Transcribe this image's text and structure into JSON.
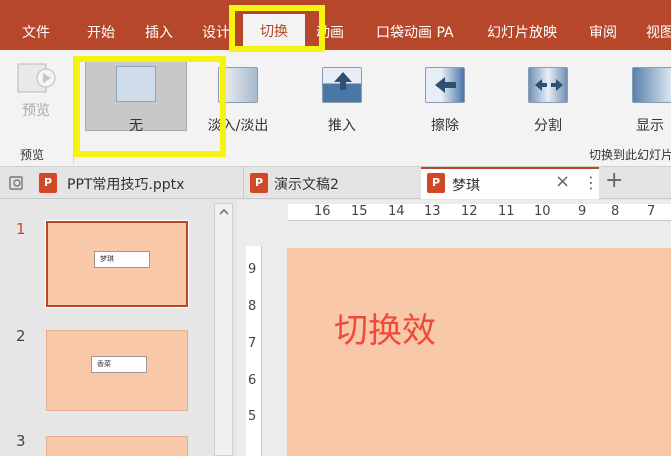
{
  "ribbon_tabs": [
    "文件",
    "开始",
    "插入",
    "设计",
    "切换",
    "动画",
    "口袋动画 PA",
    "幻灯片放映",
    "审阅",
    "视图"
  ],
  "active_tab": "切换",
  "preview_group": {
    "button_label": "预览",
    "group_label": "预览"
  },
  "transitions": [
    {
      "label": "无",
      "selected": true
    },
    {
      "label": "淡入/淡出"
    },
    {
      "label": "推入"
    },
    {
      "label": "擦除"
    },
    {
      "label": "分割"
    },
    {
      "label": "显示"
    }
  ],
  "transition_group_label": "切换到此幻灯片",
  "document_tabs": [
    {
      "title": "PPT常用技巧.pptx"
    },
    {
      "title": "演示文稿2"
    },
    {
      "title": "梦琪",
      "active": true
    }
  ],
  "new_tab_symbol": "+",
  "slides": [
    {
      "number": "1",
      "box_text": "梦琪",
      "active": true
    },
    {
      "number": "2",
      "box_text": "香菜"
    },
    {
      "number": "3"
    }
  ],
  "ruler_h": [
    "16",
    "15",
    "14",
    "13",
    "12",
    "11",
    "10",
    "9",
    "8",
    "7"
  ],
  "ruler_v": [
    "9",
    "8",
    "7",
    "6",
    "5"
  ],
  "slide_title": "切换效",
  "colors": {
    "accent": "#b7472a",
    "highlight": "#f6f313",
    "slide_bg": "#f8c8a8",
    "slide_text": "#ef4b3a"
  }
}
